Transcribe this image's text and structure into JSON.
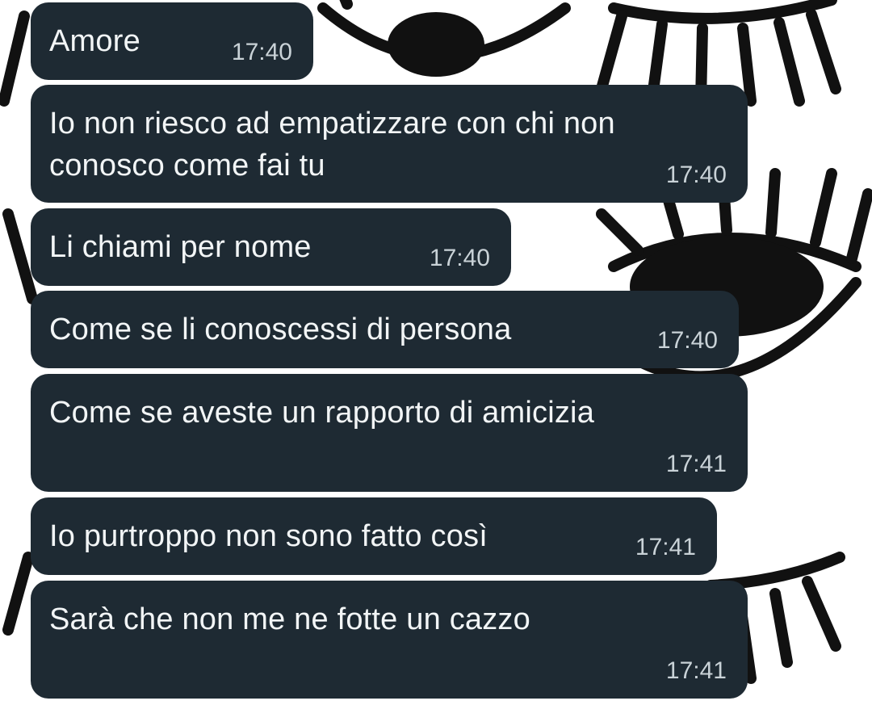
{
  "theme": {
    "bubble_color": "#1e2a33",
    "text_color": "#f2f5f6",
    "time_color": "#c9d2d7",
    "wallpaper_color": "#ffffff",
    "wallpaper_pattern_color": "#111111"
  },
  "wallpaper": {
    "pattern_icon": "eyelash-eye-icon"
  },
  "messages": [
    {
      "text": "Amore",
      "time": "17:40"
    },
    {
      "text": "Io non riesco ad empatizzare con chi non\nconosco come fai tu",
      "time": "17:40"
    },
    {
      "text": "Li chiami per nome",
      "time": "17:40"
    },
    {
      "text": "Come se li conoscessi di persona",
      "time": "17:40"
    },
    {
      "text": "Come se aveste un rapporto di amicizia",
      "time": "17:41"
    },
    {
      "text": "Io purtroppo non sono fatto così",
      "time": "17:41"
    },
    {
      "text": "Sarà che non me ne fotte un cazzo",
      "time": "17:41"
    }
  ]
}
